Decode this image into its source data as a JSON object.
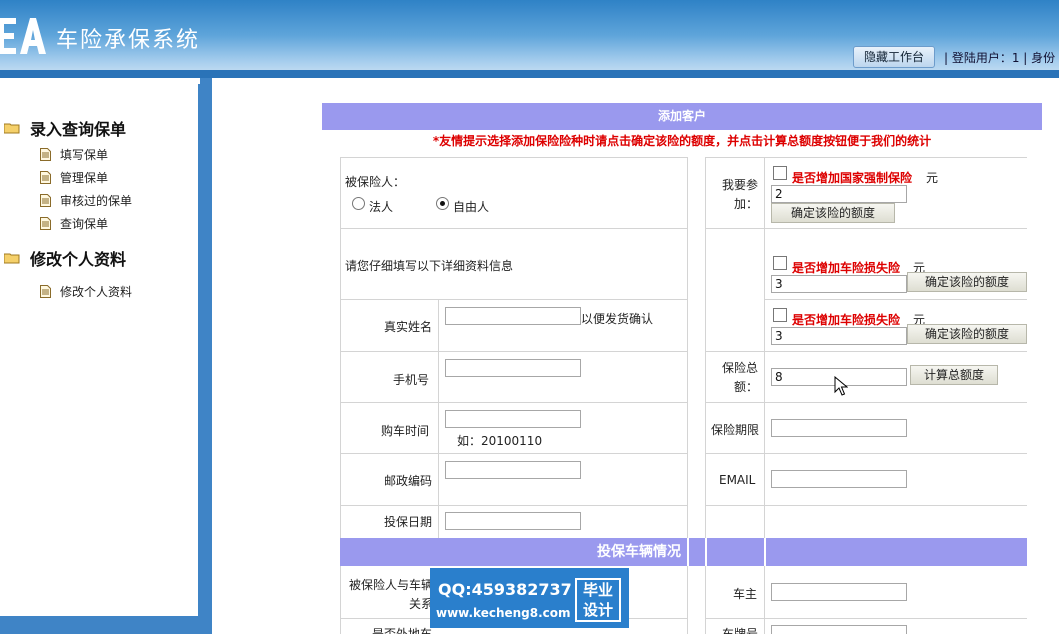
{
  "header": {
    "app_title": "车险承保系统",
    "hide_workbench_label": "隐藏工作台",
    "userbar_text": "| 登陆用户：1 | 身份"
  },
  "sidebar": {
    "groups": [
      {
        "label": "录入查询保单",
        "items": [
          "填写保单",
          "管理保单",
          "审核过的保单",
          "查询保单"
        ]
      },
      {
        "label": "修改个人资料",
        "items": [
          "修改个人资料"
        ]
      }
    ]
  },
  "form": {
    "panel_title": "添加客户",
    "tip": "*友情提示选择添加保险险种时请点击确定该险的额度，并点击计算总额度按钮便于我们的统计",
    "insured_label": "被保险人：",
    "radio_legal": "法人",
    "radio_free": "自由人",
    "selected_radio": "自由人",
    "detail_hint": "请您仔细填写以下详细资料信息",
    "name_label": "真实姓名",
    "name_value": "",
    "name_hint": "以便发货确认",
    "phone_label": "手机号",
    "phone_value": "",
    "buy_date_label": "购车时间",
    "buy_date_value": "",
    "buy_date_hint": "如：20100110",
    "postcode_label": "邮政编码",
    "postcode_value": "",
    "insure_date_label": "投保日期",
    "insure_date_value": "",
    "join_label_1": "我要参",
    "join_label_2": "加：",
    "ins1_label": "是否增加国家强制保险",
    "ins1_unit": "元",
    "ins1_value": "2",
    "ins2_label": "是否增加车险损失险",
    "ins2_unit": "元",
    "ins2_value": "3",
    "ins3_label": "是否增加车险损失险",
    "ins3_unit": "元",
    "ins3_value": "3",
    "confirm_label": "确定该险的额度",
    "total_label_1": "保险总",
    "total_label_2": "额：",
    "total_value": "8",
    "calc_total_label": "计算总额度",
    "period_label": "保险期限",
    "period_value": "",
    "email_label": "EMAIL",
    "email_value": "",
    "vehicle_section_title": "投保车辆情况",
    "relation_label_1": "被保险人与车辆",
    "relation_label_2": "关系",
    "owner_label": "车主",
    "owner_value": "",
    "foreign_label": "是否外地车",
    "plate_label": "车牌号"
  },
  "watermark": {
    "qq": "QQ:459382737",
    "url": "www.kecheng8.com",
    "badge_line1": "毕业",
    "badge_line2": "设计"
  },
  "colors": {
    "header_blue": "#2f82c6",
    "panel_purple": "#9a99ee",
    "tip_red": "#dd0000"
  }
}
